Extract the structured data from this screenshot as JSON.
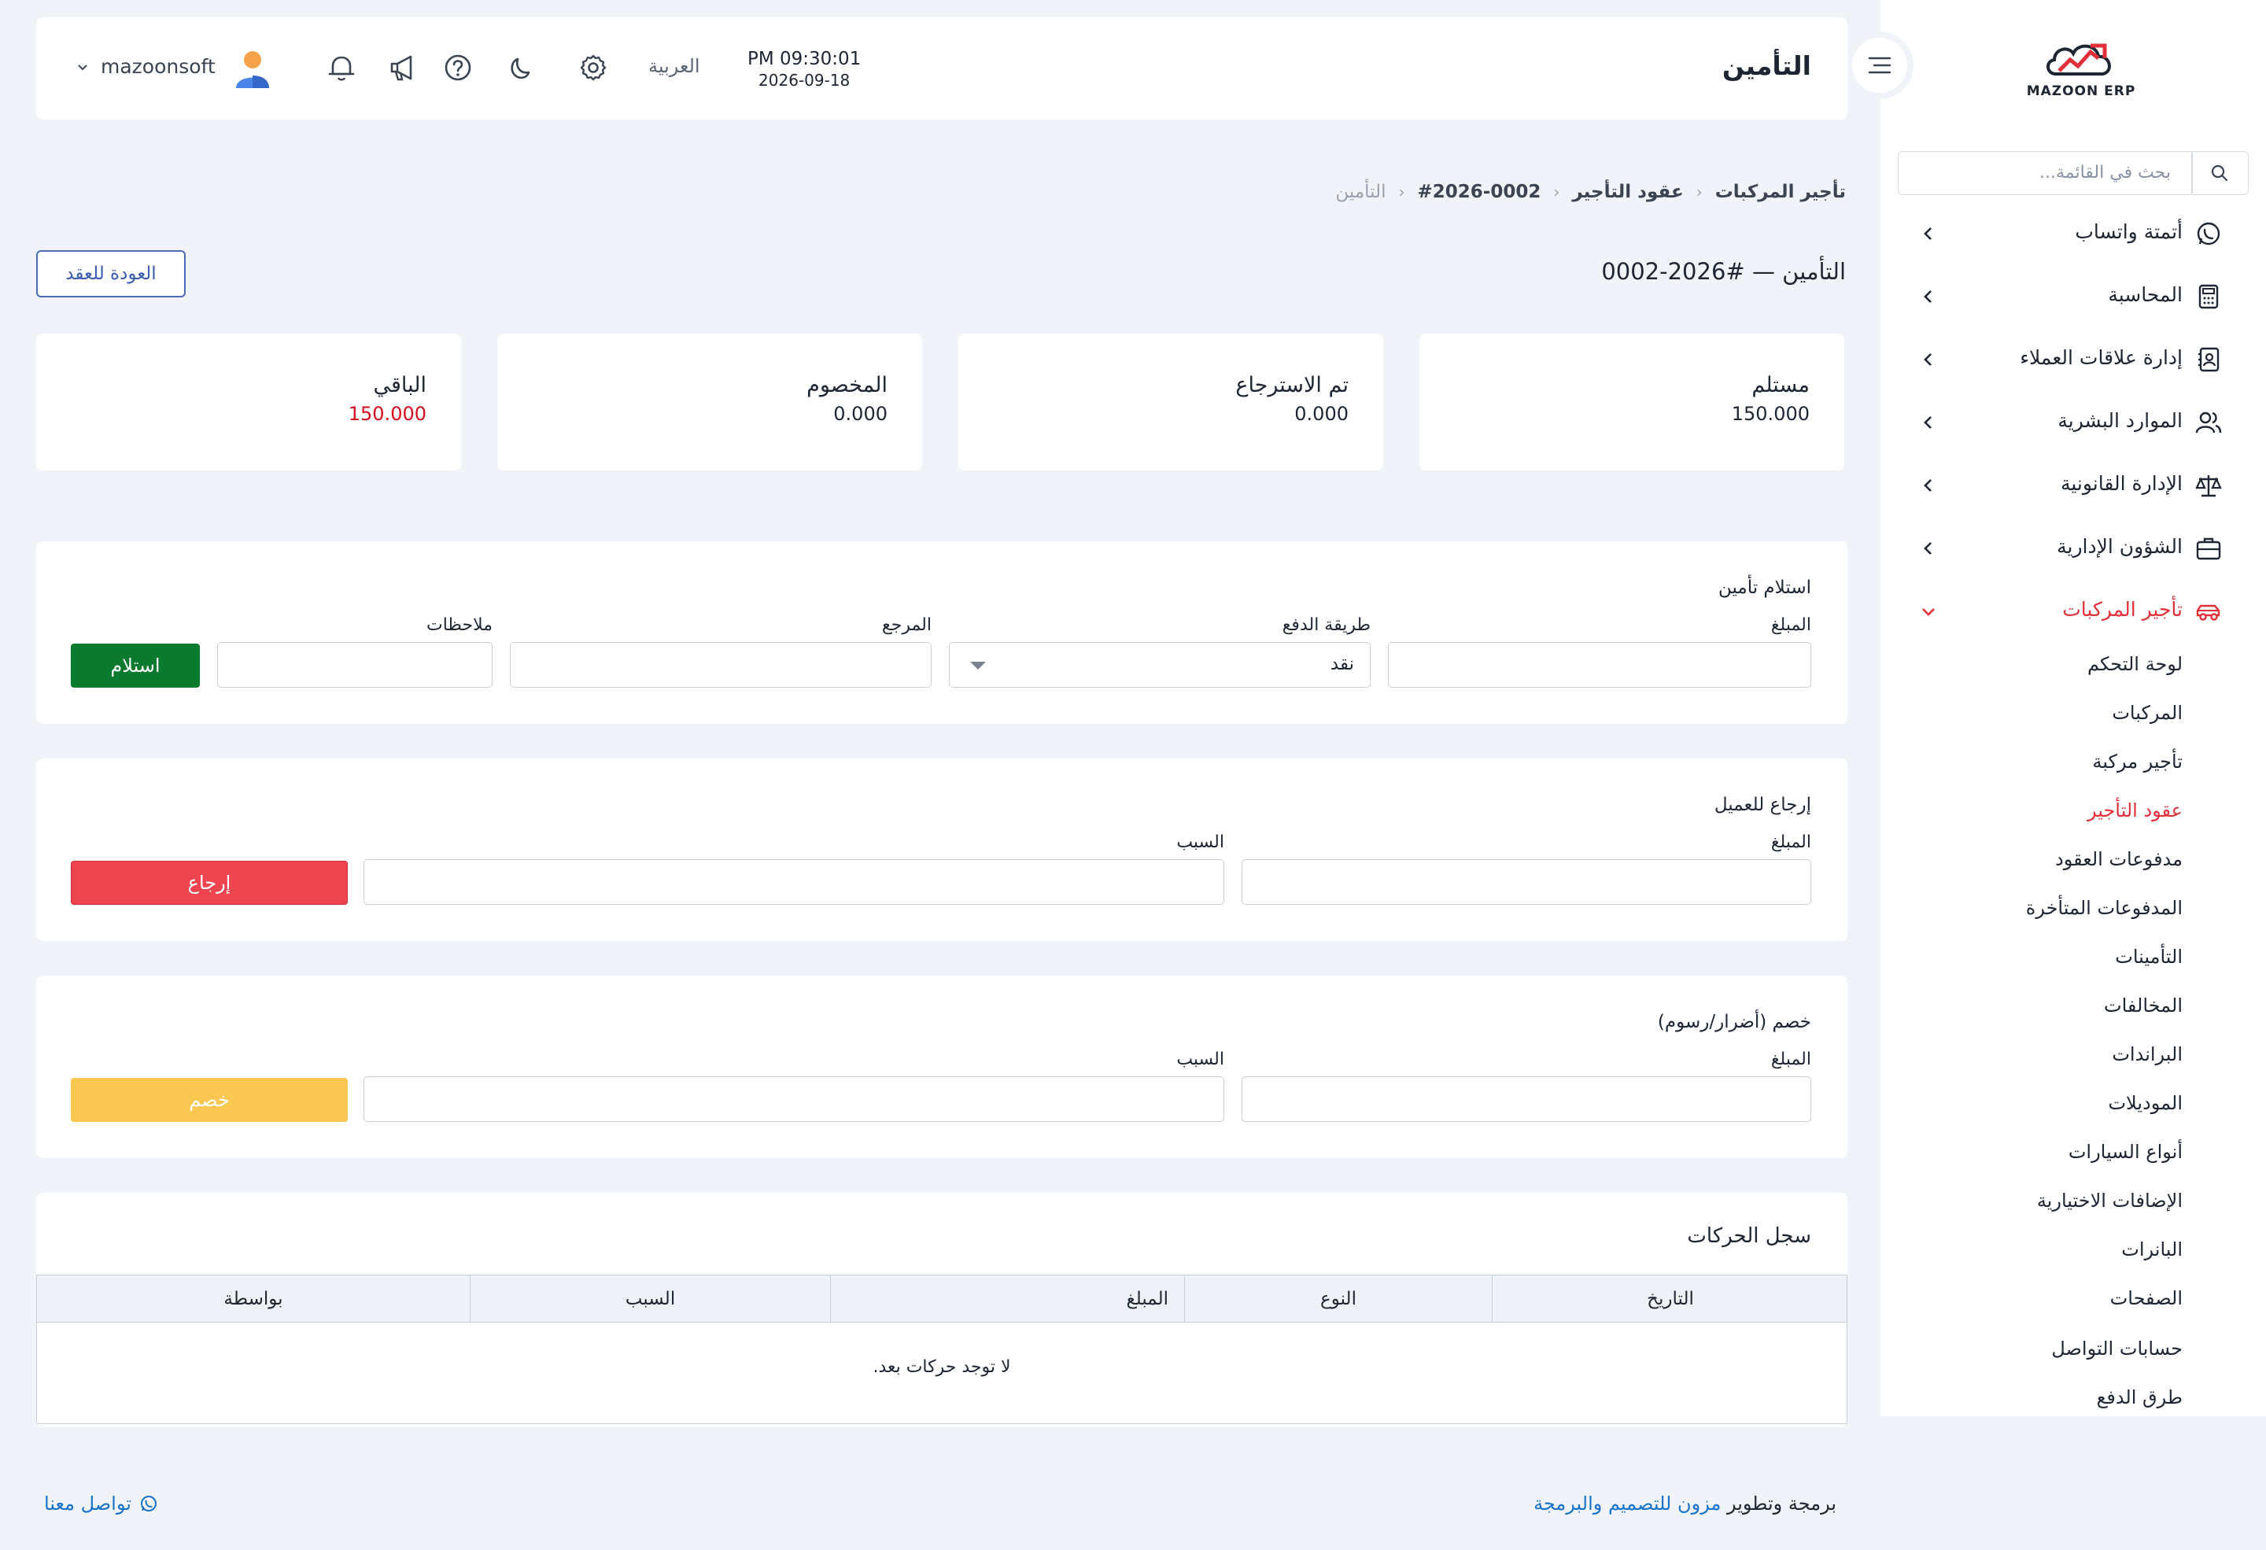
{
  "app": {
    "logo_text": "MAZOON ERP",
    "page_title": "التأمين",
    "clock_time": "PM 09:30:01",
    "clock_date": "2026-09-18",
    "language": "العربية",
    "user_name": "mazoonsoft"
  },
  "sidebar": {
    "search_placeholder": "بحث في القائمة...",
    "items": [
      {
        "label": "أتمتة واتساب",
        "icon": "whatsapp-icon"
      },
      {
        "label": "المحاسبة",
        "icon": "calculator-icon"
      },
      {
        "label": "إدارة علاقات العملاء",
        "icon": "contacts-book-icon"
      },
      {
        "label": "الموارد البشرية",
        "icon": "users-icon"
      },
      {
        "label": "الإدارة القانونية",
        "icon": "scale-icon"
      },
      {
        "label": "الشؤون الإدارية",
        "icon": "briefcase-icon"
      },
      {
        "label": "تأجير المركبات",
        "icon": "car-icon",
        "active": true
      }
    ],
    "subitems": [
      "لوحة التحكم",
      "المركبات",
      "تأجير مركبة",
      "عقود التأجير",
      "مدفوعات العقود",
      "المدفوعات المتأخرة",
      "التأمينات",
      "المخالفات",
      "البراندات",
      "الموديلات",
      "أنواع السيارات",
      "الإضافات الاختيارية",
      "البانرات",
      "الصفحات",
      "حسابات التواصل",
      "طرق الدفع"
    ],
    "active_subitem_index": 3,
    "active_color": "#e2303b"
  },
  "breadcrumb": {
    "items": [
      "تأجير المركبات",
      "عقود التأجير",
      "#2026-0002"
    ],
    "current": "التأمين"
  },
  "section": {
    "title": "التأمين — #2026-0002",
    "back_button": "العودة للعقد"
  },
  "stats": [
    {
      "label": "مستلم",
      "value": "150.000"
    },
    {
      "label": "تم الاسترجاع",
      "value": "0.000"
    },
    {
      "label": "المخصوم",
      "value": "0.000"
    },
    {
      "label": "الباقي",
      "value": "150.000",
      "color": "#d40f1b"
    }
  ],
  "receive_form": {
    "title": "استلام تأمين",
    "amount_label": "المبلغ",
    "amount_value": "",
    "method_label": "طريقة الدفع",
    "method_value": "نقد",
    "reference_label": "المرجع",
    "reference_value": "",
    "notes_label": "ملاحظات",
    "notes_value": "",
    "submit": "استلام"
  },
  "refund_form": {
    "title": "إرجاع للعميل",
    "amount_label": "المبلغ",
    "amount_value": "",
    "reason_label": "السبب",
    "reason_value": "",
    "submit": "إرجاع"
  },
  "deduct_form": {
    "title": "خصم (أضرار/رسوم)",
    "amount_label": "المبلغ",
    "amount_value": "",
    "reason_label": "السبب",
    "reason_value": "",
    "submit": "خصم"
  },
  "history": {
    "title": "سجل الحركات",
    "columns": [
      "التاريخ",
      "النوع",
      "المبلغ",
      "السبب",
      "بواسطة"
    ],
    "empty_text": "لا توجد حركات بعد."
  },
  "footer": {
    "credit_prefix": "برمجة وتطوير",
    "credit_brand": "مزون للتصميم والبرمجة",
    "contact": "تواصل معنا"
  },
  "colors": {
    "accent_blue": "#3a5bb0",
    "success": "#0a7a2e",
    "danger": "#ee4450",
    "warning": "#fac751"
  }
}
